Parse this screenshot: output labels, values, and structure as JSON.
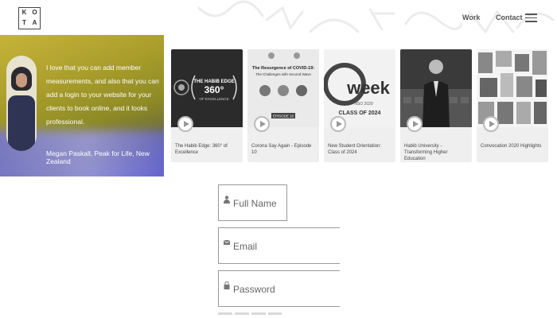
{
  "header": {
    "logo_letters": [
      "K",
      "O",
      "T",
      "A"
    ],
    "nav_work": "Work",
    "nav_contact": "Contact",
    "menu_icon": "hamburger-icon"
  },
  "testimonial": {
    "quote": "I love that you can add member measurements, and also that you can add a login to your website for your clients to book online, and it looks professional.",
    "author": "Megan Paskall, Peak for Life, New Zealand"
  },
  "videos": [
    {
      "title": "The Habib Edge: 360° of Excellence",
      "thumb_text": "THE HABIB EDGE 360° OF EXCELLENCE"
    },
    {
      "title": "Corona Say Again - Episode 10",
      "thumb_text": "The Resurgence of COVID-19: The Challenges with Second Wave",
      "thumb_sub": "EPISODE 10"
    },
    {
      "title": "New Student Orientation: Class of 2024",
      "thumb_text": "O week",
      "thumb_sub": "NSO 2020",
      "thumb_sub2": "CLASS OF 2024"
    },
    {
      "title": "Habib University - Transforming Higher Education"
    },
    {
      "title": "Convocation 2020 Highlights"
    }
  ],
  "form": {
    "full_name_placeholder": "Full Name",
    "email_placeholder": "Email",
    "password_placeholder": "Password"
  }
}
